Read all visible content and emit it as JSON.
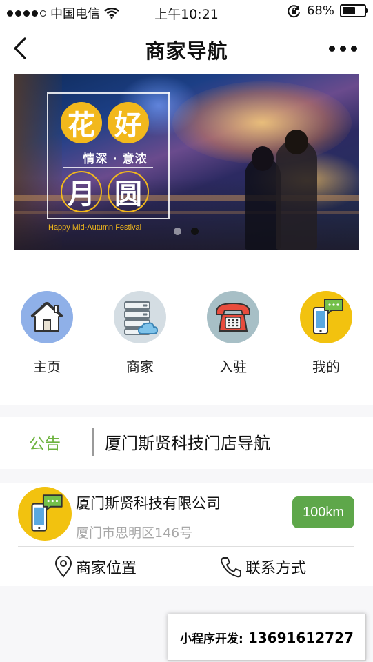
{
  "status_bar": {
    "carrier": "中国电信",
    "time": "上午10:21",
    "battery_percent": "68%",
    "battery_level": 0.68
  },
  "nav": {
    "title": "商家导航",
    "back_icon": "chevron-left-icon",
    "more_icon": "more-dots-icon"
  },
  "banner": {
    "char1": "花",
    "char2": "好",
    "subtitle": "情深 · 意浓",
    "char3": "月",
    "char4": "圆",
    "english": "Happy Mid-Autumn Festival",
    "slide_count": 2,
    "active_slide": 2
  },
  "menu": {
    "items": [
      {
        "label": "主页",
        "icon": "home-icon",
        "color": "#8fb0e8"
      },
      {
        "label": "商家",
        "icon": "server-cloud-icon",
        "color": "#d4dde3"
      },
      {
        "label": "入驻",
        "icon": "telephone-icon",
        "color": "#a7bfc6"
      },
      {
        "label": "我的",
        "icon": "phone-chat-icon",
        "color": "#f2c20f"
      }
    ]
  },
  "notice": {
    "tag": "公告",
    "text": "厦门斯贤科技门店导航"
  },
  "merchant": {
    "name": "厦门斯贤科技有限公司",
    "address": "厦门市思明区146号",
    "distance": "100km",
    "location_label": "商家位置",
    "contact_label": "联系方式",
    "accent": "#5ea74a"
  },
  "ad": {
    "label": "小程序开发:",
    "phone": "13691612727"
  }
}
